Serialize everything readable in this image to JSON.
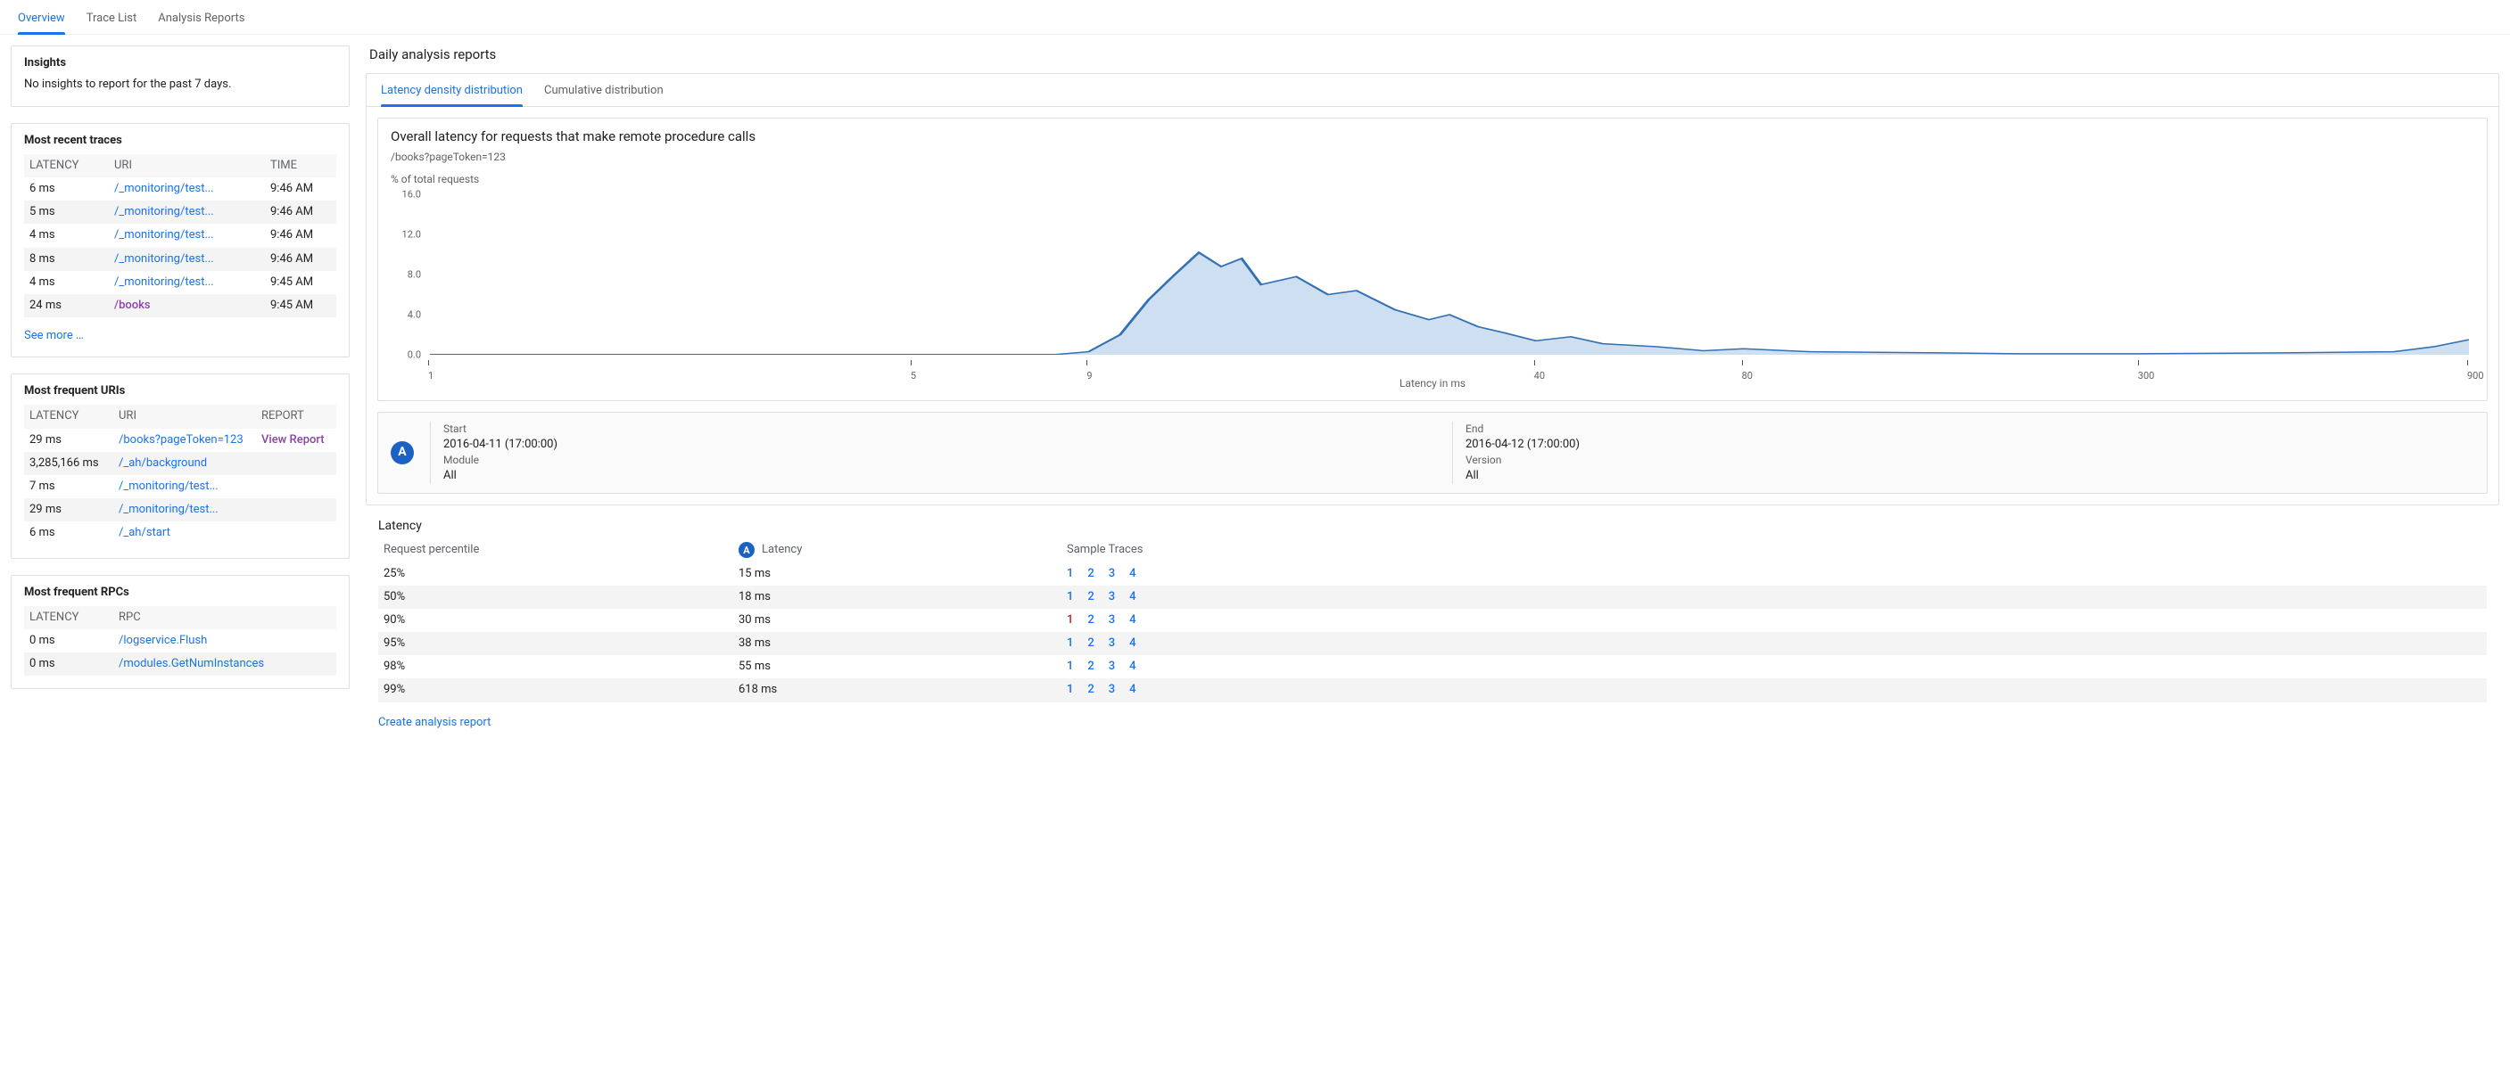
{
  "tabs": {
    "overview": "Overview",
    "trace_list": "Trace List",
    "analysis_reports": "Analysis Reports"
  },
  "insights": {
    "title": "Insights",
    "text": "No insights to report for the past 7 days."
  },
  "recent": {
    "title": "Most recent traces",
    "cols": {
      "latency": "LATENCY",
      "uri": "URI",
      "time": "TIME"
    },
    "rows": [
      {
        "latency": "6 ms",
        "uri": "/_monitoring/test...",
        "time": "9:46 AM"
      },
      {
        "latency": "5 ms",
        "uri": "/_monitoring/test...",
        "time": "9:46 AM"
      },
      {
        "latency": "4 ms",
        "uri": "/_monitoring/test...",
        "time": "9:46 AM"
      },
      {
        "latency": "8 ms",
        "uri": "/_monitoring/test...",
        "time": "9:46 AM"
      },
      {
        "latency": "4 ms",
        "uri": "/_monitoring/test...",
        "time": "9:45 AM"
      },
      {
        "latency": "24 ms",
        "uri": "/books",
        "time": "9:45 AM",
        "purple": true
      }
    ],
    "see_more": "See more …"
  },
  "freq_uris": {
    "title": "Most frequent URIs",
    "cols": {
      "latency": "LATENCY",
      "uri": "URI",
      "report": "REPORT"
    },
    "rows": [
      {
        "latency": "29 ms",
        "uri": "/books?pageToken=123",
        "report": "View Report"
      },
      {
        "latency": "3,285,166 ms",
        "uri": "/_ah/background"
      },
      {
        "latency": "7 ms",
        "uri": "/_monitoring/test..."
      },
      {
        "latency": "29 ms",
        "uri": "/_monitoring/test..."
      },
      {
        "latency": "6 ms",
        "uri": "/_ah/start"
      }
    ]
  },
  "freq_rpcs": {
    "title": "Most frequent RPCs",
    "cols": {
      "latency": "LATENCY",
      "rpc": "RPC"
    },
    "rows": [
      {
        "latency": "0 ms",
        "rpc": "/logservice.Flush"
      },
      {
        "latency": "0 ms",
        "rpc": "/modules.GetNumInstances"
      }
    ]
  },
  "daily": {
    "title": "Daily analysis reports",
    "subtabs": {
      "density": "Latency density distribution",
      "cumulative": "Cumulative distribution"
    },
    "chart_title": "Overall latency for requests that make remote procedure calls",
    "chart_path": "/books?pageToken=123",
    "y_label": "% of total requests",
    "x_label": "Latency in ms",
    "runinfo": {
      "badge": "A",
      "start_k": "Start",
      "start_v": "2016-04-11 (17:00:00)",
      "module_k": "Module",
      "module_v": "All",
      "end_k": "End",
      "end_v": "2016-04-12 (17:00:00)",
      "version_k": "Version",
      "version_v": "All"
    },
    "latency_section": "Latency",
    "pcols": {
      "p": "Request percentile",
      "l": "Latency",
      "s": "Sample Traces",
      "badge": "A"
    },
    "prows": [
      {
        "p": "25%",
        "l": "15 ms",
        "s": [
          "1",
          "2",
          "3",
          "4"
        ]
      },
      {
        "p": "50%",
        "l": "18 ms",
        "s": [
          "1",
          "2",
          "3",
          "4"
        ]
      },
      {
        "p": "90%",
        "l": "30 ms",
        "s": [
          "1",
          "2",
          "3",
          "4"
        ],
        "hot": 0
      },
      {
        "p": "95%",
        "l": "38 ms",
        "s": [
          "1",
          "2",
          "3",
          "4"
        ]
      },
      {
        "p": "98%",
        "l": "55 ms",
        "s": [
          "1",
          "2",
          "3",
          "4"
        ]
      },
      {
        "p": "99%",
        "l": "618 ms",
        "s": [
          "1",
          "2",
          "3",
          "4"
        ]
      }
    ],
    "create": "Create analysis report"
  },
  "chart_data": {
    "type": "area",
    "title": "Overall latency for requests that make remote procedure calls",
    "xlabel": "Latency in ms",
    "ylabel": "% of total requests",
    "x_scale": "log",
    "ylim": [
      0,
      16
    ],
    "x_ticks": [
      1,
      5,
      9,
      40,
      80,
      300,
      900
    ],
    "y_ticks": [
      0.0,
      4.0,
      8.0,
      12.0,
      16.0
    ],
    "series": [
      {
        "name": "A",
        "x": [
          1,
          5,
          8,
          9,
          10,
          11,
          12,
          13,
          14,
          15,
          16,
          18,
          20,
          22,
          25,
          28,
          30,
          33,
          36,
          40,
          45,
          50,
          60,
          70,
          80,
          100,
          150,
          200,
          300,
          500,
          700,
          800,
          900
        ],
        "values": [
          0,
          0,
          0,
          0.3,
          2.0,
          5.5,
          8.0,
          10.2,
          8.8,
          9.6,
          7.0,
          7.8,
          6.0,
          6.4,
          4.5,
          3.5,
          4.0,
          2.8,
          2.2,
          1.4,
          1.8,
          1.1,
          0.8,
          0.4,
          0.6,
          0.3,
          0.2,
          0.1,
          0.1,
          0.2,
          0.3,
          0.8,
          1.5
        ]
      }
    ]
  }
}
